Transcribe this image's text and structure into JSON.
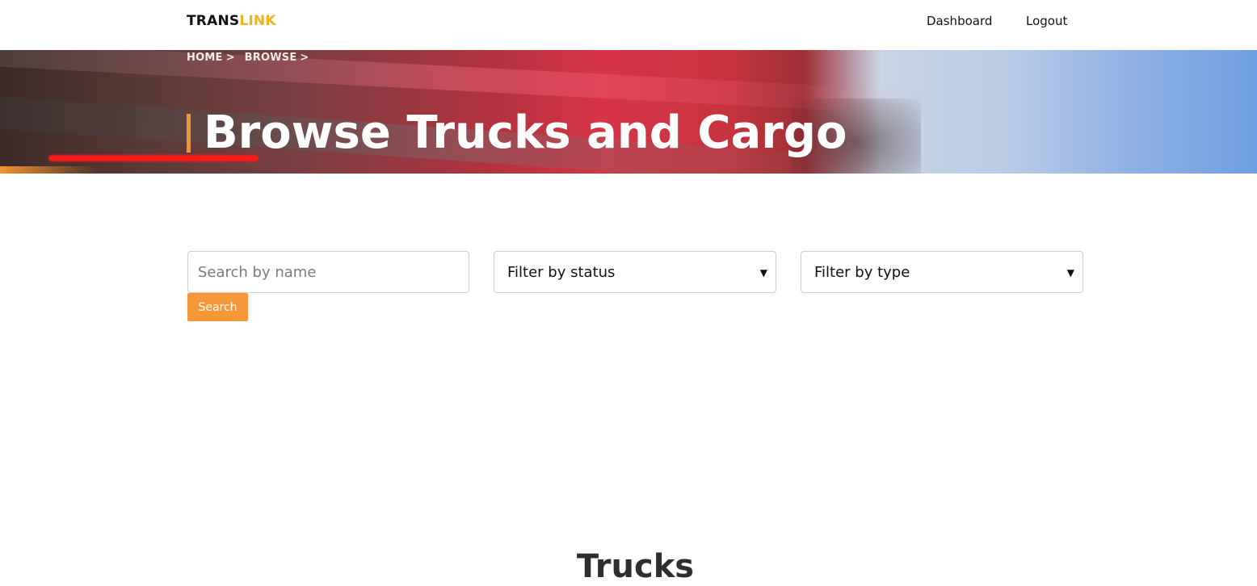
{
  "nav": {
    "logo_part1": "TRANS",
    "logo_part2": "LINK",
    "links": [
      {
        "label": "Dashboard"
      },
      {
        "label": "Logout"
      }
    ]
  },
  "hero": {
    "breadcrumb": [
      {
        "label": "HOME",
        "sep": ">"
      },
      {
        "label": "BROWSE",
        "sep": ">"
      }
    ],
    "title": "Browse Trucks and Cargo"
  },
  "filters": {
    "search_placeholder": "Search by name",
    "status_selected": "Filter by status",
    "type_selected": "Filter by type",
    "search_button": "Search"
  },
  "section": {
    "title": "Trucks"
  },
  "colors": {
    "accent": "#f49431",
    "logo_accent": "#f6b21a",
    "button": "#f79838"
  },
  "icons": {
    "select_chevron": "chevron-down-icon"
  }
}
